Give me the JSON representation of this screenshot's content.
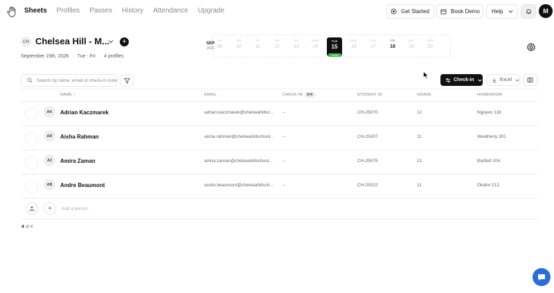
{
  "nav": {
    "links": [
      "Sheets",
      "Profiles",
      "Passes",
      "History",
      "Attendance",
      "Upgrade"
    ],
    "get_started": "Get Started",
    "book_demo": "Book Demo",
    "help": "Help",
    "avatar": "M"
  },
  "sheet": {
    "badge": "CH",
    "title": "Chelsea Hill - M...",
    "date": "September 15th, 2026",
    "days": "Tue - Fri",
    "profiles": "4 profiles"
  },
  "calendar": {
    "month": "SEP",
    "year": "2026",
    "days": [
      {
        "name": "SU",
        "num": "09"
      },
      {
        "name": "MO",
        "num": "10"
      },
      {
        "name": "TU",
        "num": "11"
      },
      {
        "name": "WE",
        "num": "12"
      },
      {
        "name": "SU",
        "num": "13"
      },
      {
        "name": "MON",
        "num": "14"
      },
      {
        "name": "TUE",
        "num": "15"
      },
      {
        "name": "WED",
        "num": "16"
      },
      {
        "name": "THU",
        "num": "17"
      },
      {
        "name": "FRI",
        "num": "18"
      },
      {
        "name": "SAT",
        "num": "19"
      },
      {
        "name": "SUN",
        "num": "20"
      }
    ],
    "today_label": "Today"
  },
  "toolbar": {
    "search_placeholder": "Search by name, email or check-in code",
    "checkin": "Check-in",
    "excel": "Excel"
  },
  "table": {
    "headers": {
      "name": "NAME",
      "email": "EMAIL",
      "checkin": "CHECK-IN",
      "checkin_count": "0/4",
      "student_id": "STUDENT ID",
      "grade": "GRADE",
      "homeroom": "HOMEROOM"
    },
    "rows": [
      {
        "initials": "AK",
        "name": "Adrian Kaczmarek",
        "email": "adrian.kaczmarek@chelseahillsc...",
        "checkin": "–",
        "student_id": "CH-25070",
        "grade": "12",
        "homeroom": "Nguyen 118"
      },
      {
        "initials": "AR",
        "name": "Aisha Rahman",
        "email": "aisha.rahman@chelseahillschool...",
        "checkin": "–",
        "student_id": "CH-25007",
        "grade": "11",
        "homeroom": "Weatherly 301"
      },
      {
        "initials": "AZ",
        "name": "Amira Zaman",
        "email": "amira.zaman@chelseahillschool...",
        "checkin": "–",
        "student_id": "CH-25075",
        "grade": "12",
        "homeroom": "Bartlett 204"
      },
      {
        "initials": "AB",
        "name": "Andre Beaumont",
        "email": "andre.beaumont@chelseahillsch...",
        "checkin": "–",
        "student_id": "CH-25022",
        "grade": "11",
        "homeroom": "Okafor 212"
      }
    ],
    "add_person": "Add a person"
  },
  "pager": {
    "current": "4",
    "of": "of 4"
  }
}
